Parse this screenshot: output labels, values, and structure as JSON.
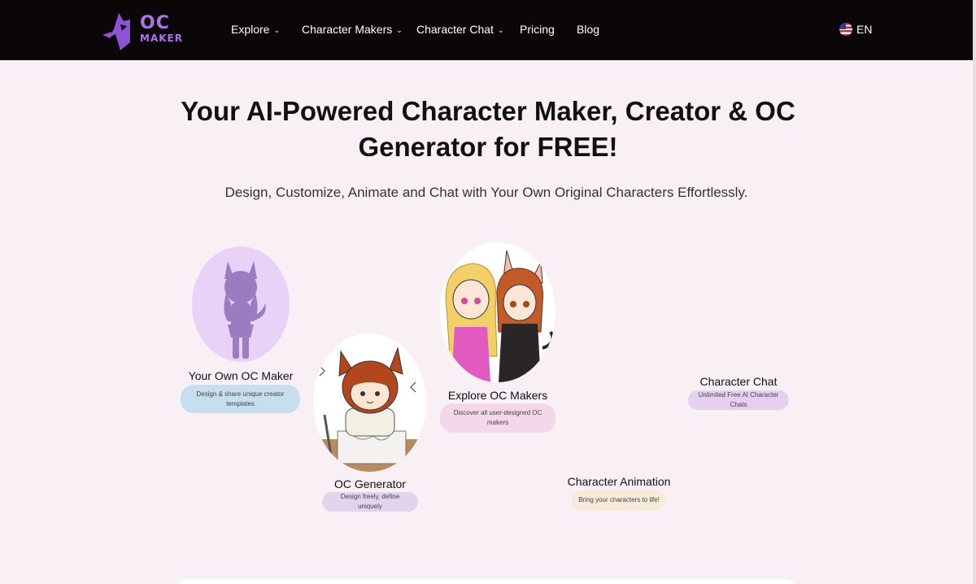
{
  "nav": {
    "logo_line1": "OC",
    "logo_line2": "MAKER",
    "items": [
      {
        "label": "Explore",
        "dropdown": true
      },
      {
        "label": "Character Makers",
        "dropdown": true
      },
      {
        "label": "Character Chat",
        "dropdown": true
      },
      {
        "label": "Pricing",
        "dropdown": false
      },
      {
        "label": "Blog",
        "dropdown": false
      }
    ],
    "language": "EN"
  },
  "hero": {
    "title_line1": "Your AI-Powered Character Maker, Creator & OC",
    "title_line2": "Generator for FREE!",
    "subtitle": "Design, Customize, Animate and Chat with Your Own Original Characters Effortlessly."
  },
  "features": [
    {
      "title": "Your Own OC Maker",
      "desc": "Design & share unique creator templates",
      "pill_color": "#c6dff0"
    },
    {
      "title": "OC Generator",
      "desc": "Design freely, define uniquely",
      "pill_color": "#e2d3ef"
    },
    {
      "title": "Explore OC Makers",
      "desc": "Discover all user-designed OC makers",
      "pill_color": "#f4d8ea"
    },
    {
      "title": "Character Animation",
      "desc": "Bring your characters to life!",
      "pill_color": "#f6ebd9"
    },
    {
      "title": "Character Chat",
      "desc": "Unlimited Free AI Character Chats",
      "pill_color": "#e6d0ef"
    }
  ],
  "colors": {
    "navbar_bg": "#0b0608",
    "page_bg": "#f8f0f4",
    "brand_purple": "#a974e8"
  }
}
